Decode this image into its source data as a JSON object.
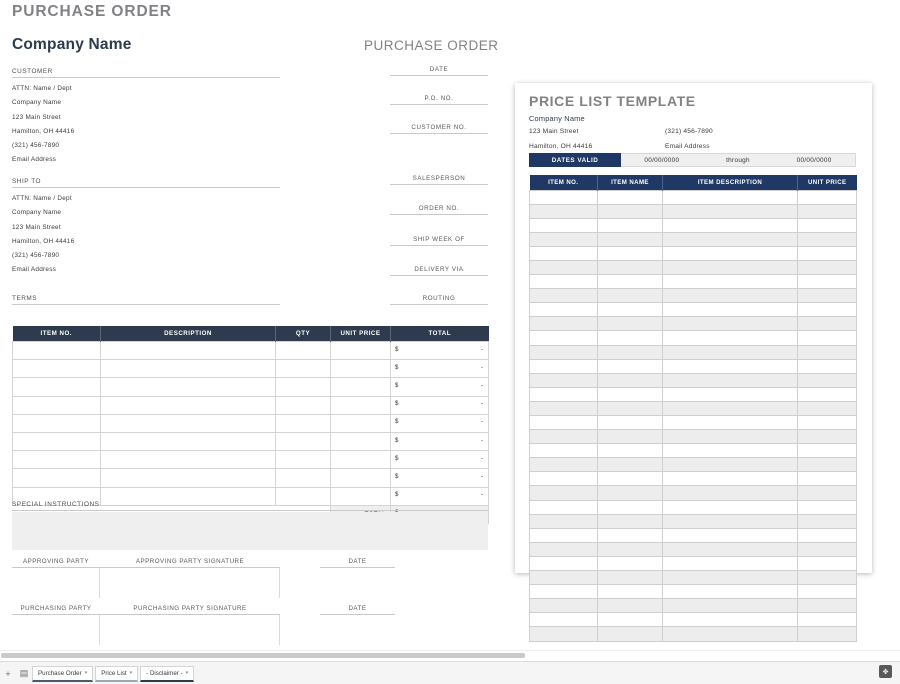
{
  "purchase_order": {
    "doc_title": "PURCHASE ORDER",
    "company_name": "Company Name",
    "po_word": "PURCHASE ORDER",
    "customer_block": {
      "header": "CUSTOMER",
      "lines": [
        "ATTN: Name / Dept",
        "Company Name",
        "123 Main Street",
        "Hamilton, OH  44416",
        "(321) 456-7890",
        "Email Address"
      ]
    },
    "ship_to_block": {
      "header": "SHIP TO",
      "lines": [
        "ATTN: Name / Dept",
        "Company Name",
        "123 Main Street",
        "Hamilton, OH  44416",
        "(321) 456-7890",
        "Email Address"
      ]
    },
    "terms_label": "TERMS",
    "right_fields": [
      {
        "label": "DATE"
      },
      {
        "label": "P.O. NO."
      },
      {
        "label": "CUSTOMER NO."
      },
      {
        "label": "SALESPERSON"
      },
      {
        "label": "ORDER NO."
      },
      {
        "label": "SHIP WEEK OF"
      },
      {
        "label": "DELIVERY VIA"
      },
      {
        "label": "ROUTING"
      }
    ],
    "items_table": {
      "columns": [
        "ITEM NO.",
        "DESCRIPTION",
        "QTY",
        "UNIT PRICE",
        "TOTAL"
      ],
      "row_count": 9,
      "currency_symbol": "$",
      "empty_value": "-",
      "total_label": "TOTAL"
    },
    "special_instructions_label": "SPECIAL INSTRUCTIONS",
    "signatures": [
      {
        "party": "APPROVING PARTY",
        "signature": "APPROVING PARTY SIGNATURE",
        "date": "DATE"
      },
      {
        "party": "PURCHASING PARTY",
        "signature": "PURCHASING PARTY SIGNATURE",
        "date": "DATE"
      }
    ]
  },
  "price_list": {
    "title": "PRICE LIST TEMPLATE",
    "company_name": "Company Name",
    "address_line": "123 Main Street",
    "city_line": "Hamilton, OH 44416",
    "phone": "(321) 456-7890",
    "email": "Email Address",
    "dates_valid_label": "DATES VALID",
    "date_from": "00/00/0000",
    "through_label": "through",
    "date_to": "00/00/0000",
    "table": {
      "columns": [
        "ITEM NO.",
        "ITEM NAME",
        "ITEM DESCRIPTION",
        "UNIT PRICE"
      ],
      "row_count": 32
    }
  },
  "bottom_bar": {
    "add_sheet_icon": "+",
    "all_sheets_icon": "▤",
    "tabs": [
      {
        "label": "Purchase Order",
        "caret": "▾",
        "state": "active"
      },
      {
        "label": "Price List",
        "caret": "▾",
        "state": "normal"
      },
      {
        "label": "- Disclaimer -",
        "caret": "▾",
        "state": "disclaimer"
      }
    ],
    "corner_button_icon": "✥"
  },
  "colors": {
    "po_header_bar": "#2e3b4e",
    "price_list_header_bar": "#1f3864",
    "title_gray": "#808285",
    "row_alt": "#ededed",
    "panel_gray": "#efefef"
  }
}
